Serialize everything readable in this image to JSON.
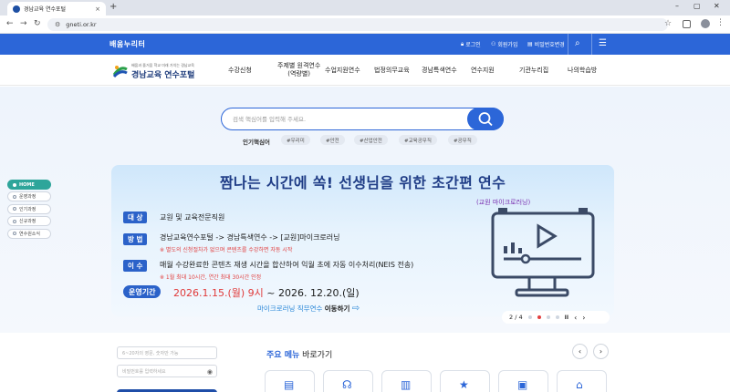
{
  "browser": {
    "tab_title": "경남교육 연수포털",
    "tab_close": "×",
    "new_tab": "+",
    "url": "gneti.or.kr",
    "win_min": "–",
    "win_max": "▢",
    "win_close": "✕"
  },
  "utility": {
    "logo": "배움누리터",
    "login": "로그인",
    "join": "회원가입",
    "password": "비밀번호변경"
  },
  "site": {
    "logo_sub": "배움과 즐거움 학교 미래 가치는 경남교육",
    "logo_main": "경남교육 연수포털"
  },
  "menu": [
    {
      "label": "수강신청"
    },
    {
      "label": "주제별 원격연수\n(역량별)"
    },
    {
      "label": "수업지원연수"
    },
    {
      "label": "법정의무교육"
    },
    {
      "label": "경남특색연수"
    },
    {
      "label": "연수지원"
    },
    {
      "label": "기관누리집"
    },
    {
      "label": "나의학습방"
    }
  ],
  "search": {
    "placeholder": "검색 핵심어를 입력해 주세요.",
    "keyword_label": "인기핵심어",
    "keywords": [
      "#우리미",
      "#안전",
      "#산업안전",
      "#교육공무직",
      "#공무직"
    ]
  },
  "side_nav": [
    {
      "label": "HOME"
    },
    {
      "label": "운영과정"
    },
    {
      "label": "인기과정"
    },
    {
      "label": "신규과정"
    },
    {
      "label": "연수원소식"
    }
  ],
  "banner": {
    "title": "짬나는 시간에 쏙! 선생님을 위한 초간편 연수",
    "subtitle": "(교원 마이크로러닝)",
    "target_label": "대 상",
    "target_text": "교원 및 교육전문직원",
    "method_label": "방 법",
    "method_text": "경남교육연수포털 -> 경남특색연수 -> [교원]마이크로러닝",
    "method_note": "※ 별도의 신청절차가 없으며 콘텐츠를 수강하면 자동 시작",
    "credit_label": "이 수",
    "credit_text": "매월 수강완료한 콘텐츠 재생 시간을 합산하여 익월 초에 자동 이수처리(NEIS 전송)",
    "credit_note": "※ 1월 최대 10시간, 연간 최대 30시간 인정",
    "period_label": "운영기간",
    "period_start": "2026.1.15.(월) 9시",
    "period_sep": " ~ ",
    "period_end": "2026. 12.20.(일)",
    "link_text": "마이크로러닝 직무연수",
    "link_bold": "이동하기"
  },
  "pager": {
    "current": "2 / 4",
    "pause": "II"
  },
  "login": {
    "id_placeholder": "6~20자의 영문, 숫자만 가능",
    "pw_placeholder": "비밀번호를 입력하세요"
  },
  "quick": {
    "title_bold": "주요 메뉴",
    "title_rest": " 바로가기",
    "prev": "‹",
    "next": "›"
  },
  "colors": {
    "primary": "#2c66d8",
    "accent_teal": "#2ea59a",
    "note_red": "#e24040"
  }
}
